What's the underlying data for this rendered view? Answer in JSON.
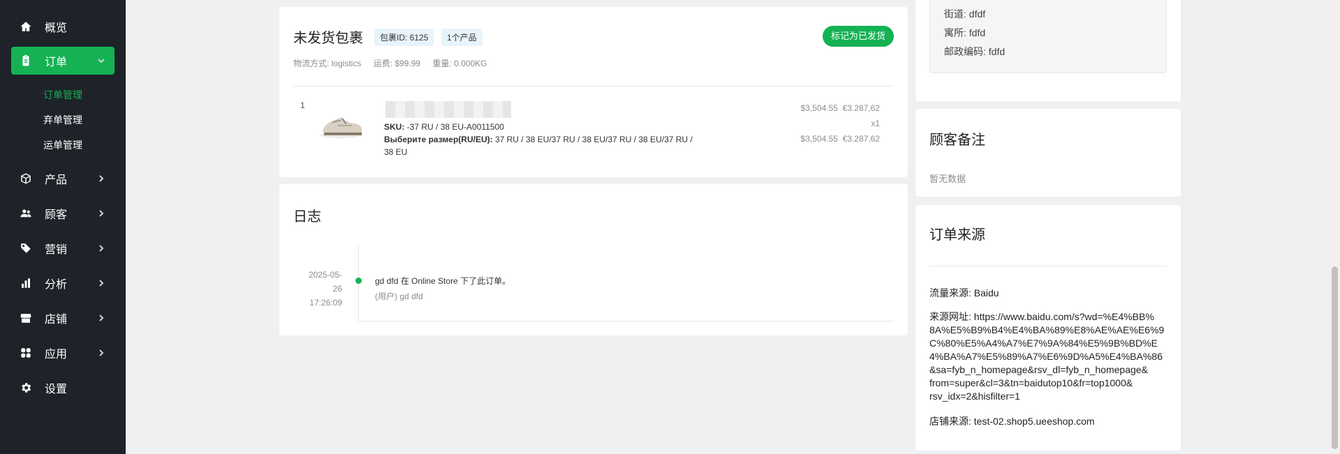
{
  "sidebar": {
    "items": [
      {
        "label": "概览",
        "icon": "home-icon"
      },
      {
        "label": "订单",
        "icon": "clipboard-icon"
      },
      {
        "label": "产品",
        "icon": "box-icon"
      },
      {
        "label": "顾客",
        "icon": "users-icon"
      },
      {
        "label": "营销",
        "icon": "tag-icon"
      },
      {
        "label": "分析",
        "icon": "chart-icon"
      },
      {
        "label": "店铺",
        "icon": "store-icon"
      },
      {
        "label": "应用",
        "icon": "apps-icon"
      },
      {
        "label": "设置",
        "icon": "gear-icon"
      }
    ],
    "sub_items": [
      "订单管理",
      "弃单管理",
      "运单管理"
    ]
  },
  "package": {
    "title": "未发货包裹",
    "package_id_tag": "包裹ID: 6125",
    "product_count_tag": "1个产品",
    "mark_shipped_button": "标记为已发货",
    "shipping_method": "物流方式: logistics",
    "shipping_fee": "运费: $99.99",
    "weight": "重量: 0.000KG",
    "item": {
      "index": "1",
      "sku_label": "SKU:",
      "sku_value": " -37 RU / 38 EU-A0011500",
      "option_label": "Выберите размер(RU/EU):",
      "option_value": " 37 RU / 38 EU/37 RU / 38 EU/37 RU / 38 EU/37 RU / 38 EU",
      "unit_price_usd": "$3,504.55",
      "unit_price_eur": "€3.287,62",
      "qty": "x1",
      "total_usd": "$3,504.55",
      "total_eur": "€3.287,62"
    }
  },
  "log": {
    "title": "日志",
    "entries": [
      {
        "date": "2025-05-26",
        "time": "17:26:09",
        "message": "gd dfd 在 Online Store 下了此订单。",
        "user": "(用户) gd dfd"
      }
    ]
  },
  "address": {
    "street": "街道: dfdf",
    "apartment": "寓所: fdfd",
    "postal_code": "邮政编码: fdfd"
  },
  "customer_notes": {
    "title": "顾客备注",
    "empty": "暂无数据"
  },
  "order_source": {
    "title": "订单来源",
    "traffic_source": "流量来源: Baidu",
    "source_url_lines": [
      "来源网址: https://www.baidu.com/s?wd=%E4%BB%",
      "8A%E5%B9%B4%E4%BA%89%E8%AE%AE%E6%9",
      "C%80%E5%A4%A7%E7%9A%84%E5%9B%BD%E",
      "4%BA%A7%E5%89%A7%E6%9D%A5%E4%BA%86",
      "&sa=fyb_n_homepage&rsv_dl=fyb_n_homepage&",
      "from=super&cl=3&tn=baidutop10&fr=top1000&",
      "rsv_idx=2&hisfilter=1"
    ],
    "store_source": "店铺来源: test-02.shop5.ueeshop.com"
  }
}
